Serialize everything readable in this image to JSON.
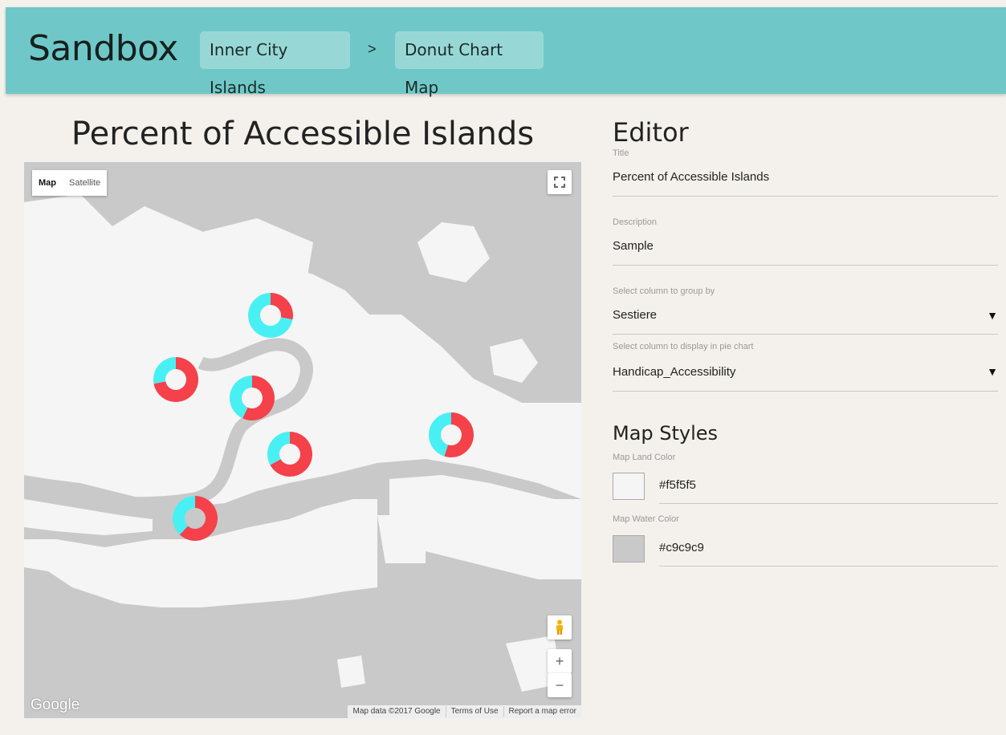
{
  "app": {
    "brand": "Sandbox",
    "breadcrumb": [
      "Inner City Islands",
      "Donut Chart Map"
    ],
    "breadcrumb_separator": ">"
  },
  "chart": {
    "title": "Percent of Accessible Islands"
  },
  "map": {
    "type_options": [
      "Map",
      "Satellite"
    ],
    "selected_type": "Map",
    "logo": "Google",
    "attribution": [
      "Map data ©2017 Google",
      "Terms of Use",
      "Report a map error"
    ],
    "land_color": "#f5f5f5",
    "water_color": "#c9c9c9",
    "series_colors": {
      "accessible": "#49f0f3",
      "not_accessible": "#f4414a"
    },
    "donuts": [
      {
        "accessible_fraction": 0.72
      },
      {
        "accessible_fraction": 0.28
      },
      {
        "accessible_fraction": 0.43
      },
      {
        "accessible_fraction": 0.33
      },
      {
        "accessible_fraction": 0.45
      },
      {
        "accessible_fraction": 0.38
      }
    ]
  },
  "editor": {
    "heading": "Editor",
    "title_label": "Title",
    "title_value": "Percent of Accessible Islands",
    "description_label": "Description",
    "description_value": "Sample",
    "group_label": "Select column to group by",
    "group_value": "Sestiere",
    "pie_label": "Select column to display in pie chart",
    "pie_value": "Handicap_Accessibility",
    "map_styles_heading": "Map Styles",
    "land_label": "Map Land Color",
    "land_value": "#f5f5f5",
    "water_label": "Map Water Color",
    "water_value": "#c9c9c9"
  }
}
